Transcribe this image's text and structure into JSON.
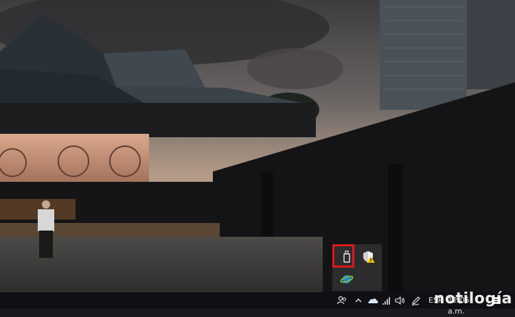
{
  "tray_popup": {
    "icons": [
      "usb-safely-remove-icon",
      "windows-security-warning-icon",
      "network-globe-icon"
    ]
  },
  "taskbar": {
    "icons": [
      "people-icon",
      "show-hidden-chevron-icon",
      "onedrive-icon",
      "wifi-icon",
      "volume-icon",
      "pen-icon"
    ],
    "language": "ESP",
    "time": "12:05 a.m.",
    "notification_icon": "action-center-icon"
  },
  "watermark": {
    "text": "notilogía"
  },
  "colors": {
    "highlight": "#e01919",
    "taskbar": "#0f1013",
    "tray_popup": "#2e2e30"
  }
}
